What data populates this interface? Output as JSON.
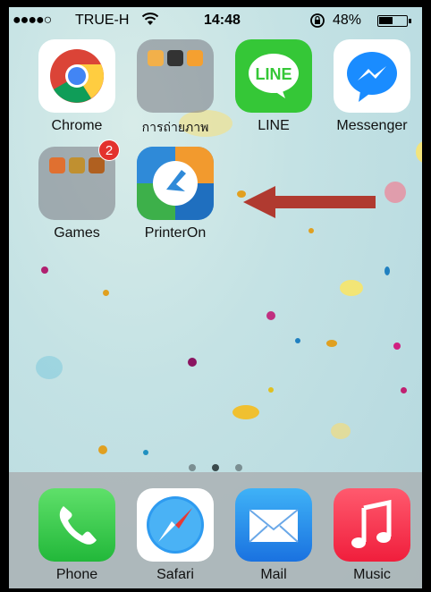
{
  "status": {
    "signal": "●●●●○",
    "carrier": "TRUE-H",
    "time": "14:48",
    "battery_percent": "48%",
    "battery_level": 0.48
  },
  "apps": {
    "chrome": "Chrome",
    "photo_folder": "การถ่ายภาพ",
    "line": "LINE",
    "line_logo": "LINE",
    "messenger": "Messenger",
    "games": "Games",
    "games_badge": "2",
    "printeron": "PrinterOn"
  },
  "dock": {
    "phone": "Phone",
    "safari": "Safari",
    "mail": "Mail",
    "music": "Music"
  },
  "page_indicator": {
    "pages": 3,
    "active_index": 1
  },
  "colors": {
    "line_green": "#35c737",
    "messenger_blue": "#1a8cff",
    "badge_red": "#e3322d",
    "arrow_red": "#b03a30",
    "phone_green": "#3fc94a",
    "mail_blue": "#2f8df2",
    "music_red": "#f8314a"
  }
}
